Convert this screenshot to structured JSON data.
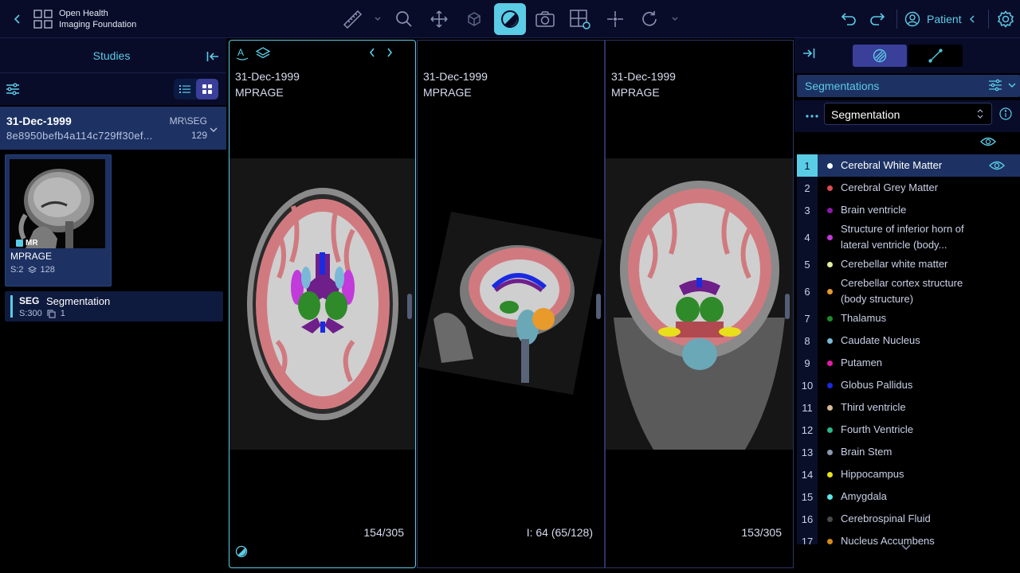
{
  "header": {
    "logo_line1": "Open Health",
    "logo_line2": "Imaging Foundation",
    "patient_label": "Patient"
  },
  "studies_panel": {
    "title": "Studies",
    "study": {
      "date": "31-Dec-1999",
      "uid": "8e8950befb4a114c729ff30ef...",
      "modalities": "MR\\SEG",
      "instance_count": "129"
    },
    "series": [
      {
        "modality_badge": "MR",
        "description": "MPRAGE",
        "series_number": "S:2",
        "instances": "128"
      },
      {
        "modality_badge": "SEG",
        "description": "Segmentation",
        "series_number": "S:300",
        "instances": "1"
      }
    ]
  },
  "viewports": [
    {
      "date": "31-Dec-1999",
      "description": "MPRAGE",
      "slice": "154/305"
    },
    {
      "date": "31-Dec-1999",
      "description": "MPRAGE",
      "slice": "I: 64 (65/128)"
    },
    {
      "date": "31-Dec-1999",
      "description": "MPRAGE",
      "slice": "153/305"
    }
  ],
  "segmentation_panel": {
    "header": "Segmentations",
    "selected": "Segmentation",
    "segments": [
      {
        "index": "1",
        "label": "Cerebral White Matter",
        "color": "#ffffff"
      },
      {
        "index": "2",
        "label": "Cerebral Grey Matter",
        "color": "#e04a55"
      },
      {
        "index": "3",
        "label": "Brain ventricle",
        "color": "#8a1aa8"
      },
      {
        "index": "4",
        "label": "Structure of inferior horn of lateral ventricle (body...",
        "color": "#c23ad9"
      },
      {
        "index": "5",
        "label": "Cerebellar white matter",
        "color": "#e0f0a0"
      },
      {
        "index": "6",
        "label": "Cerebellar cortex structure (body structure)",
        "color": "#e89a2a"
      },
      {
        "index": "7",
        "label": "Thalamus",
        "color": "#1f8a2a"
      },
      {
        "index": "8",
        "label": "Caudate Nucleus",
        "color": "#7ab8d8"
      },
      {
        "index": "9",
        "label": "Putamen",
        "color": "#e81aa8"
      },
      {
        "index": "10",
        "label": "Globus Pallidus",
        "color": "#1a2ae0"
      },
      {
        "index": "11",
        "label": "Third ventricle",
        "color": "#d8b898"
      },
      {
        "index": "12",
        "label": "Fourth Ventricle",
        "color": "#2ab88a"
      },
      {
        "index": "13",
        "label": "Brain Stem",
        "color": "#8a98b0"
      },
      {
        "index": "14",
        "label": "Hippocampus",
        "color": "#e8e01a"
      },
      {
        "index": "15",
        "label": "Amygdala",
        "color": "#5ae8e8"
      },
      {
        "index": "16",
        "label": "Cerebrospinal Fluid",
        "color": "#4a4a4a"
      },
      {
        "index": "17",
        "label": "Nucleus Accumbens",
        "color": "#d8881a"
      }
    ]
  },
  "colors": {
    "accent": "#5acce6",
    "panel_bg": "#090c29",
    "selected_bg": "#1d3263",
    "active_tool": "#5acce6",
    "indigo": "#3a3f99"
  },
  "icons": [
    "chevron-left-icon",
    "grid-logo-icon",
    "ruler-icon",
    "magnify-icon",
    "move-icon",
    "rotate-3d-icon",
    "contrast-icon",
    "camera-icon",
    "layout-icon",
    "crosshair-icon",
    "reset-icon",
    "undo-icon",
    "redo-icon",
    "user-icon",
    "gear-icon",
    "collapse-icon",
    "filter-icon",
    "list-view-icon",
    "grid-view-icon",
    "eye-icon",
    "info-icon",
    "more-dots-icon",
    "brush-icon",
    "measure-icon"
  ]
}
